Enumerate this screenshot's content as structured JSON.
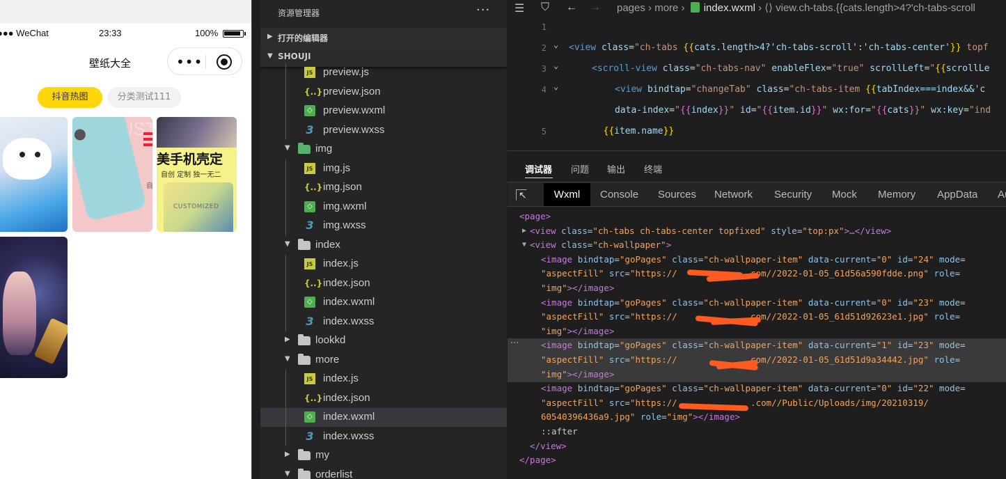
{
  "simulator": {
    "status": {
      "carrier": "●●● WeChat",
      "time": "23:33",
      "battery": "100%"
    },
    "nav": {
      "title": "壁纸大全",
      "menu_dots": "•••"
    },
    "tabs": [
      {
        "label": "抖音热图",
        "active": true
      },
      {
        "label": "分类测试111",
        "active": false
      }
    ],
    "thumbs": {
      "t2_word": "CUSTOM",
      "t2_side": "自",
      "t3_headline": "美手机壳定",
      "t3_sub": "自创  定制  独一无二",
      "t3_custom": "CUSTOMIZED"
    }
  },
  "explorer": {
    "title": "资源管理器",
    "more": "···",
    "sections": [
      {
        "label": "打开的编辑器",
        "expanded": false
      },
      {
        "label": "SHOUJI",
        "expanded": true
      }
    ],
    "tree": [
      {
        "name": "preview.js",
        "type": "js"
      },
      {
        "name": "preview.json",
        "type": "json"
      },
      {
        "name": "preview.wxml",
        "type": "wxml"
      },
      {
        "name": "preview.wxss",
        "type": "wxss"
      },
      {
        "name": "img",
        "type": "folder-img",
        "expanded": true
      },
      {
        "name": "img.js",
        "type": "js"
      },
      {
        "name": "img.json",
        "type": "json"
      },
      {
        "name": "img.wxml",
        "type": "wxml"
      },
      {
        "name": "img.wxss",
        "type": "wxss"
      },
      {
        "name": "index",
        "type": "folder",
        "expanded": true
      },
      {
        "name": "index.js",
        "type": "js"
      },
      {
        "name": "index.json",
        "type": "json"
      },
      {
        "name": "index.wxml",
        "type": "wxml"
      },
      {
        "name": "index.wxss",
        "type": "wxss"
      },
      {
        "name": "lookkd",
        "type": "folder",
        "expanded": false
      },
      {
        "name": "more",
        "type": "folder",
        "expanded": true
      },
      {
        "name": "index.js",
        "type": "js"
      },
      {
        "name": "index.json",
        "type": "json"
      },
      {
        "name": "index.wxml",
        "type": "wxml",
        "selected": true
      },
      {
        "name": "index.wxss",
        "type": "wxss"
      },
      {
        "name": "my",
        "type": "folder",
        "expanded": false
      },
      {
        "name": "orderlist",
        "type": "folder",
        "expanded": true
      }
    ]
  },
  "editor": {
    "breadcrumb": {
      "path": "pages › more › ",
      "file": "index.wxml",
      "rest": " › ⟨⟩ view.ch-tabs.{{cats.length>4?'ch-tabs-scroll"
    },
    "lines": [
      {
        "n": "1",
        "fold": false,
        "indent": 0,
        "tokens": []
      },
      {
        "n": "2",
        "fold": true,
        "indent": 0,
        "tokens": [
          [
            "t-tag",
            "<view "
          ],
          [
            "t-attr",
            "class"
          ],
          [
            "t-eq",
            "="
          ],
          [
            "t-str",
            "\"ch-tabs "
          ],
          [
            "t-br",
            "{{"
          ],
          [
            "t-var",
            "cats.length>4?'ch-tabs-scroll':'ch-tabs-center'"
          ],
          [
            "t-br",
            "}}"
          ],
          [
            "t-str",
            " topf"
          ]
        ]
      },
      {
        "n": "3",
        "fold": true,
        "indent": 1,
        "tokens": [
          [
            "t-tag",
            "<scroll-view "
          ],
          [
            "t-attr",
            "class"
          ],
          [
            "t-eq",
            "="
          ],
          [
            "t-str",
            "\"ch-tabs-nav\" "
          ],
          [
            "t-attr",
            "enableFlex"
          ],
          [
            "t-eq",
            "="
          ],
          [
            "t-str",
            "\"true\" "
          ],
          [
            "t-attr",
            "scrollLeft"
          ],
          [
            "t-eq",
            "="
          ],
          [
            "t-str",
            "\""
          ],
          [
            "t-br",
            "{{"
          ],
          [
            "t-var",
            "scrollLe"
          ]
        ]
      },
      {
        "n": "4",
        "fold": true,
        "indent": 2,
        "tokens": [
          [
            "t-tag",
            "<view "
          ],
          [
            "t-attr",
            "bindtap"
          ],
          [
            "t-eq",
            "="
          ],
          [
            "t-str",
            "\"changeTab\" "
          ],
          [
            "t-attr",
            "class"
          ],
          [
            "t-eq",
            "="
          ],
          [
            "t-str",
            "\"ch-tabs-item "
          ],
          [
            "t-br",
            "{{"
          ],
          [
            "t-var",
            "tabIndex===index&&'c"
          ]
        ]
      },
      {
        "n": "",
        "fold": false,
        "indent": 2,
        "tokens": [
          [
            "t-attr",
            "data-index"
          ],
          [
            "t-eq",
            "="
          ],
          [
            "t-str",
            "\""
          ],
          [
            "t-br2",
            "{{"
          ],
          [
            "t-var",
            "index"
          ],
          [
            "t-br2",
            "}}"
          ],
          [
            "t-str",
            "\" "
          ],
          [
            "t-attr",
            "id"
          ],
          [
            "t-eq",
            "="
          ],
          [
            "t-str",
            "\""
          ],
          [
            "t-br2",
            "{{"
          ],
          [
            "t-var",
            "item.id"
          ],
          [
            "t-br2",
            "}}"
          ],
          [
            "t-str",
            "\" "
          ],
          [
            "t-attr",
            "wx:for"
          ],
          [
            "t-eq",
            "="
          ],
          [
            "t-str",
            "\""
          ],
          [
            "t-br2",
            "{{"
          ],
          [
            "t-var",
            "cats"
          ],
          [
            "t-br2",
            "}}"
          ],
          [
            "t-str",
            "\" "
          ],
          [
            "t-attr",
            "wx:key"
          ],
          [
            "t-eq",
            "="
          ],
          [
            "t-str",
            "\"ind"
          ]
        ]
      },
      {
        "n": "5",
        "fold": false,
        "indent": 1.5,
        "tokens": [
          [
            "t-br",
            "{{"
          ],
          [
            "t-var",
            "item.name"
          ],
          [
            "t-br",
            "}}"
          ]
        ]
      }
    ]
  },
  "debugger": {
    "tabs": [
      "调试器",
      "问题",
      "输出",
      "终端"
    ],
    "panels": [
      "Wxml",
      "Console",
      "Sources",
      "Network",
      "Security",
      "Mock",
      "Memory",
      "AppData",
      "Audits"
    ],
    "wxml": [
      {
        "indent": 0,
        "tw": "",
        "tokens": [
          [
            "x-tag",
            "<page>"
          ]
        ]
      },
      {
        "indent": 1,
        "tw": "▶",
        "tokens": [
          [
            "x-tag",
            "<view "
          ],
          [
            "x-attr",
            "class"
          ],
          [
            "x-plain",
            "="
          ],
          [
            "x-str",
            "\"ch-tabs ch-tabs-center topfixed\" "
          ],
          [
            "x-attr",
            "style"
          ],
          [
            "x-plain",
            "="
          ],
          [
            "x-str",
            "\"top:px\""
          ],
          [
            "x-tag",
            ">…</view>"
          ]
        ]
      },
      {
        "indent": 1,
        "tw": "▼",
        "tokens": [
          [
            "x-tag",
            "<view "
          ],
          [
            "x-attr",
            "class"
          ],
          [
            "x-plain",
            "="
          ],
          [
            "x-str",
            "\"ch-wallpaper\""
          ],
          [
            "x-tag",
            ">"
          ]
        ]
      },
      {
        "indent": 2,
        "tw": "",
        "tokens": [
          [
            "x-tag",
            "<image "
          ],
          [
            "x-attr",
            "bindtap"
          ],
          [
            "x-plain",
            "="
          ],
          [
            "x-str",
            "\"goPages\" "
          ],
          [
            "x-attr",
            "class"
          ],
          [
            "x-plain",
            "="
          ],
          [
            "x-str",
            "\"ch-wallpaper-item\" "
          ],
          [
            "x-attr",
            "data-current"
          ],
          [
            "x-plain",
            "="
          ],
          [
            "x-str",
            "\"0\" "
          ],
          [
            "x-attr",
            "id"
          ],
          [
            "x-plain",
            "="
          ],
          [
            "x-str",
            "\"24\" "
          ],
          [
            "x-attr",
            "mode"
          ],
          [
            "x-plain",
            "="
          ]
        ]
      },
      {
        "indent": 2,
        "tw": "",
        "tokens": [
          [
            "x-str",
            "\"aspectFill\" "
          ],
          [
            "x-attr",
            "src"
          ],
          [
            "x-plain",
            "="
          ],
          [
            "x-str",
            "\"https://"
          ],
          [
            "x-plain",
            "             "
          ],
          [
            "x-str",
            ".com//2022-01-05_61d56a590fdde.png\" "
          ],
          [
            "x-attr",
            "role"
          ],
          [
            "x-plain",
            "="
          ]
        ]
      },
      {
        "indent": 2,
        "tw": "",
        "tokens": [
          [
            "x-str",
            "\"img\""
          ],
          [
            "x-tag",
            "></image>"
          ]
        ]
      },
      {
        "indent": 2,
        "tw": "",
        "tokens": [
          [
            "x-tag",
            "<image "
          ],
          [
            "x-attr",
            "bindtap"
          ],
          [
            "x-plain",
            "="
          ],
          [
            "x-str",
            "\"goPages\" "
          ],
          [
            "x-attr",
            "class"
          ],
          [
            "x-plain",
            "="
          ],
          [
            "x-str",
            "\"ch-wallpaper-item\" "
          ],
          [
            "x-attr",
            "data-current"
          ],
          [
            "x-plain",
            "="
          ],
          [
            "x-str",
            "\"0\" "
          ],
          [
            "x-attr",
            "id"
          ],
          [
            "x-plain",
            "="
          ],
          [
            "x-str",
            "\"23\" "
          ],
          [
            "x-attr",
            "mode"
          ],
          [
            "x-plain",
            "="
          ]
        ]
      },
      {
        "indent": 2,
        "tw": "",
        "tokens": [
          [
            "x-str",
            "\"aspectFill\" "
          ],
          [
            "x-attr",
            "src"
          ],
          [
            "x-plain",
            "="
          ],
          [
            "x-str",
            "\"https://"
          ],
          [
            "x-plain",
            "             "
          ],
          [
            "x-str",
            ".com//2022-01-05_61d51d92623e1.jpg\" "
          ],
          [
            "x-attr",
            "role"
          ],
          [
            "x-plain",
            "="
          ]
        ]
      },
      {
        "indent": 2,
        "tw": "",
        "tokens": [
          [
            "x-str",
            "\"img\""
          ],
          [
            "x-tag",
            "></image>"
          ]
        ]
      },
      {
        "indent": 2,
        "tw": "",
        "hl": true,
        "tokens": [
          [
            "x-tag",
            "<image "
          ],
          [
            "x-attr",
            "bindtap"
          ],
          [
            "x-plain",
            "="
          ],
          [
            "x-str",
            "\"goPages\" "
          ],
          [
            "x-attr",
            "class"
          ],
          [
            "x-plain",
            "="
          ],
          [
            "x-str",
            "\"ch-wallpaper-item\" "
          ],
          [
            "x-attr",
            "data-current"
          ],
          [
            "x-plain",
            "="
          ],
          [
            "x-str",
            "\"1\" "
          ],
          [
            "x-attr",
            "id"
          ],
          [
            "x-plain",
            "="
          ],
          [
            "x-str",
            "\"23\" "
          ],
          [
            "x-attr",
            "mode"
          ],
          [
            "x-plain",
            "="
          ]
        ]
      },
      {
        "indent": 2,
        "tw": "",
        "hl": true,
        "tokens": [
          [
            "x-str",
            "\"aspectFill\" "
          ],
          [
            "x-attr",
            "src"
          ],
          [
            "x-plain",
            "="
          ],
          [
            "x-str",
            "\"https://"
          ],
          [
            "x-plain",
            "             "
          ],
          [
            "x-str",
            ".com//2022-01-05_61d51d9a34442.jpg\" "
          ],
          [
            "x-attr",
            "role"
          ],
          [
            "x-plain",
            "="
          ]
        ]
      },
      {
        "indent": 2,
        "tw": "",
        "hl": true,
        "tokens": [
          [
            "x-str",
            "\"img\""
          ],
          [
            "x-tag",
            "></image>"
          ]
        ]
      },
      {
        "indent": 2,
        "tw": "",
        "tokens": [
          [
            "x-tag",
            "<image "
          ],
          [
            "x-attr",
            "bindtap"
          ],
          [
            "x-plain",
            "="
          ],
          [
            "x-str",
            "\"goPages\" "
          ],
          [
            "x-attr",
            "class"
          ],
          [
            "x-plain",
            "="
          ],
          [
            "x-str",
            "\"ch-wallpaper-item\" "
          ],
          [
            "x-attr",
            "data-current"
          ],
          [
            "x-plain",
            "="
          ],
          [
            "x-str",
            "\"0\" "
          ],
          [
            "x-attr",
            "id"
          ],
          [
            "x-plain",
            "="
          ],
          [
            "x-str",
            "\"22\" "
          ],
          [
            "x-attr",
            "mode"
          ],
          [
            "x-plain",
            "="
          ]
        ]
      },
      {
        "indent": 2,
        "tw": "",
        "tokens": [
          [
            "x-str",
            "\"aspectFill\" "
          ],
          [
            "x-attr",
            "src"
          ],
          [
            "x-plain",
            "="
          ],
          [
            "x-str",
            "\"https://"
          ],
          [
            "x-plain",
            "              "
          ],
          [
            "x-str",
            ".com//Public/Uploads/img/20210319/"
          ]
        ]
      },
      {
        "indent": 2,
        "tw": "",
        "tokens": [
          [
            "x-str",
            "60540396436a9.jpg\" "
          ],
          [
            "x-attr",
            "role"
          ],
          [
            "x-plain",
            "="
          ],
          [
            "x-str",
            "\"img\""
          ],
          [
            "x-tag",
            "></image>"
          ]
        ]
      },
      {
        "indent": 2,
        "tw": "",
        "tokens": [
          [
            "x-pseudo",
            "::after"
          ]
        ]
      },
      {
        "indent": 1,
        "tw": "",
        "tokens": [
          [
            "x-tag",
            "</view>"
          ]
        ]
      },
      {
        "indent": 0,
        "tw": "",
        "tokens": [
          [
            "x-tag",
            "</page>"
          ]
        ]
      }
    ],
    "highlight_dots": "···"
  },
  "colors": {
    "accent_tab": "#ffd60a",
    "scribble": "#ff5a1f",
    "selection": "#37373d"
  }
}
